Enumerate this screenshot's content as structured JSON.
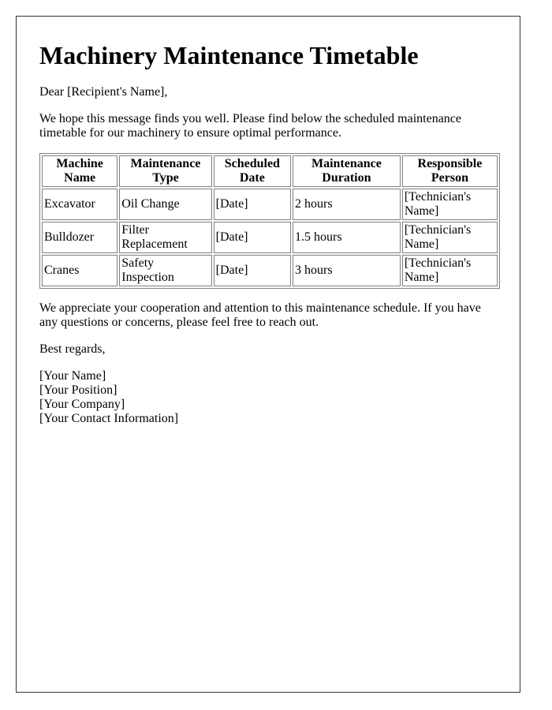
{
  "document": {
    "title": "Machinery Maintenance Timetable",
    "greeting": "Dear [Recipient's Name],",
    "intro": "We hope this message finds you well. Please find below the scheduled maintenance timetable for our machinery to ensure optimal performance.",
    "table": {
      "headers": [
        "Machine Name",
        "Maintenance Type",
        "Scheduled Date",
        "Maintenance Duration",
        "Responsible Person"
      ],
      "rows": [
        [
          "Excavator",
          "Oil Change",
          "[Date]",
          "2 hours",
          "[Technician's Name]"
        ],
        [
          "Bulldozer",
          "Filter Replacement",
          "[Date]",
          "1.5 hours",
          "[Technician's Name]"
        ],
        [
          "Cranes",
          "Safety Inspection",
          "[Date]",
          "3 hours",
          "[Technician's Name]"
        ]
      ]
    },
    "closing": "We appreciate your cooperation and attention to this maintenance schedule. If you have any questions or concerns, please feel free to reach out.",
    "regards": "Best regards,",
    "signature": [
      "[Your Name]",
      "[Your Position]",
      "[Your Company]",
      "[Your Contact Information]"
    ]
  }
}
